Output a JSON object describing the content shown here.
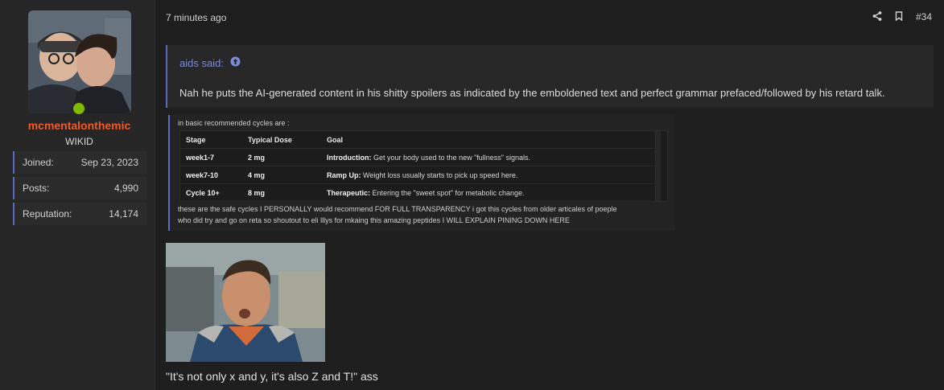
{
  "user": {
    "username": "mcmentalonthemic",
    "title": "WIKID",
    "online": true,
    "stats": [
      {
        "label": "Joined:",
        "value": "Sep 23, 2023"
      },
      {
        "label": "Posts:",
        "value": "4,990"
      },
      {
        "label": "Reputation:",
        "value": "14,174"
      }
    ]
  },
  "post": {
    "time": "7 minutes ago",
    "number": "#34",
    "icons": {
      "share": "share-icon",
      "bookmark": "bookmark-icon",
      "quote_up": "arrow-up-circle-icon"
    },
    "quote": {
      "author": "aids said:",
      "text": "Nah he puts the AI-generated content in his shitty spoilers as indicated by the emboldened text and perfect grammar prefaced/followed by his retard talk."
    },
    "embed": {
      "intro": "in basic recommended cycles are :",
      "columns": [
        "Stage",
        "Typical Dose",
        "Goal"
      ],
      "rows": [
        {
          "stage": "week1-7",
          "dose": "2 mg",
          "goal_bold": "Introduction:",
          "goal": " Get your body used to the new \"fullness\" signals."
        },
        {
          "stage": "week7-10",
          "dose": "4 mg",
          "goal_bold": "Ramp Up:",
          "goal": " Weight loss usually starts to pick up speed here."
        },
        {
          "stage": "Cycle 10+",
          "dose": "8 mg",
          "goal_bold": "Therapeutic:",
          "goal": " Entering the \"sweet spot\" for metabolic change."
        }
      ],
      "outro_line1": "these are the safe cycles I PERSONALLY would recommend FOR FULL TRANSPARENCY i got this cycles from older articales of poeple",
      "outro_line2": "who did try and go on reta so shoutout to eli lllys for mkaing this amazing peptides I WILL EXPLAIN PINING DOWN HERE"
    },
    "caption": "\"It's not only x and y, it's also Z and T!\" ass"
  },
  "colors": {
    "accent": "#5c6ac4",
    "username": "#ef5a28",
    "online": "#7fba00",
    "quote_author": "#7b8bd8"
  }
}
